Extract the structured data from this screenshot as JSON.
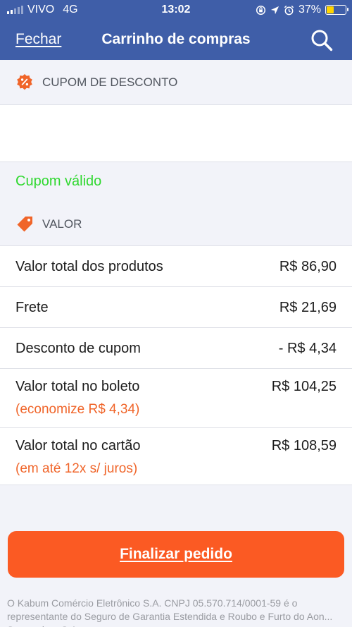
{
  "status_bar": {
    "carrier": "VIVO",
    "network": "4G",
    "time": "13:02",
    "battery_percent": "37%",
    "battery_level": 0.37,
    "signal_bars_on": 2,
    "icons": [
      "screen-rotation-lock-icon",
      "location-arrow-icon",
      "alarm-icon",
      "battery-icon"
    ]
  },
  "nav": {
    "close_label": "Fechar",
    "title": "Carrinho de compras",
    "search_icon": "search-icon"
  },
  "coupon": {
    "section_label": "CUPOM DE DESCONTO",
    "icon": "discount-badge-icon",
    "input_value": "",
    "status": "Cupom válido"
  },
  "values": {
    "section_label": "VALOR",
    "icon": "price-tag-icon",
    "rows": [
      {
        "label": "Valor total dos produtos",
        "amount": "R$ 86,90",
        "note": ""
      },
      {
        "label": "Frete",
        "amount": "R$ 21,69",
        "note": ""
      },
      {
        "label": "Desconto de cupom",
        "amount": "- R$ 4,34",
        "note": ""
      },
      {
        "label": "Valor total no boleto",
        "amount": "R$ 104,25",
        "note": "(economize R$ 4,34)"
      },
      {
        "label": "Valor total no cartão",
        "amount": "R$ 108,59",
        "note": "(em até 12x s/ juros)"
      }
    ]
  },
  "checkout": {
    "button_label": "Finalizar pedido"
  },
  "footer": {
    "legal_text": "O Kabum Comércio Eletrônico S.A. CNPJ 05.570.714/0001-59 é o representante do Seguro de Garantia Estendida e Roubo e Furto do Aon... Seguradora S.A."
  },
  "colors": {
    "header_blue": "#3f5ea8",
    "accent_orange": "#fb5a23",
    "valid_green": "#2fd82f",
    "note_orange": "#f0652a",
    "battery_yellow": "#ffd400"
  }
}
